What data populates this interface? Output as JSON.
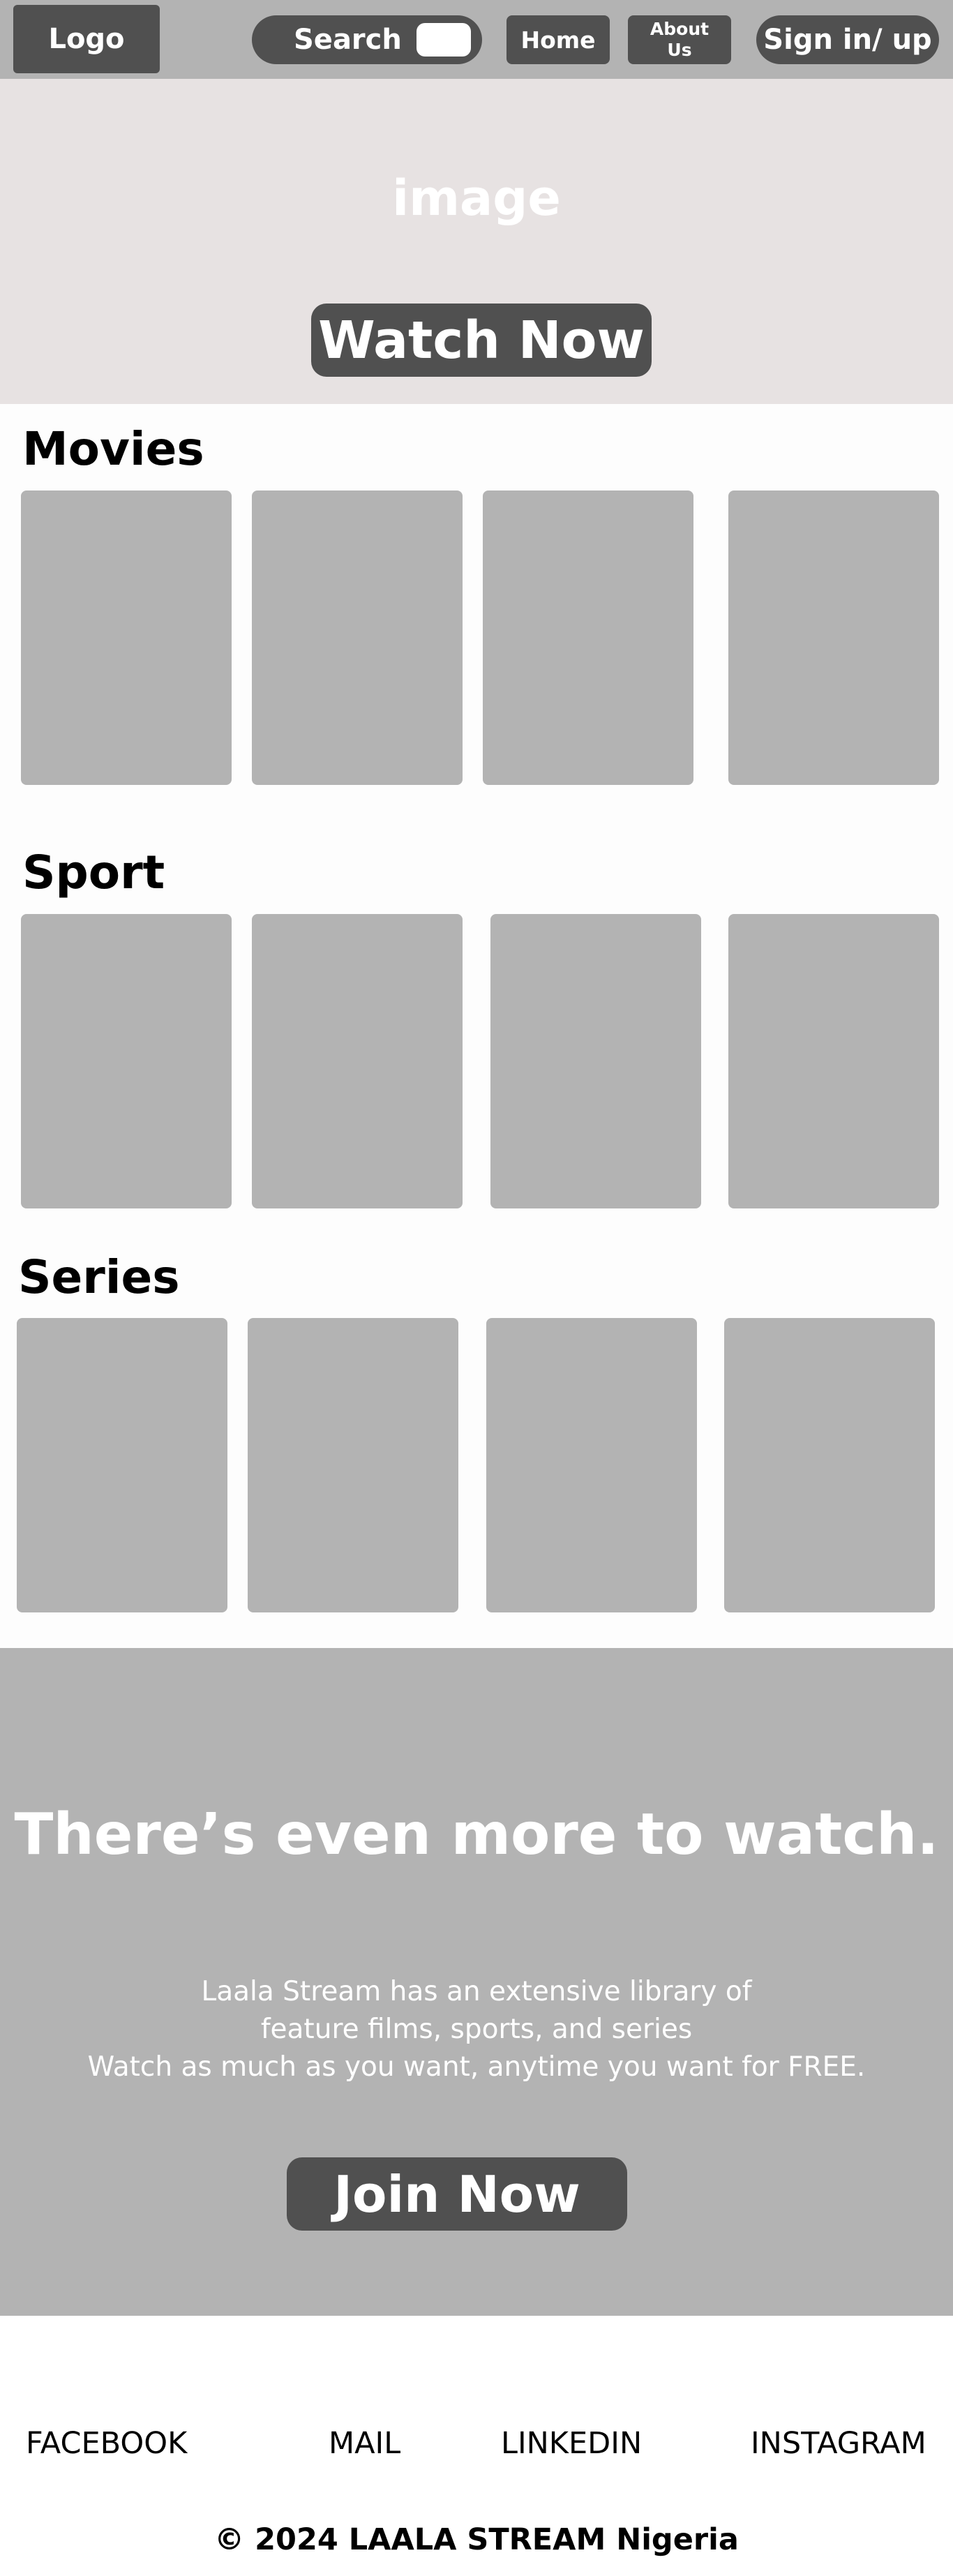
{
  "nav": {
    "logo": "Logo",
    "search_label": "Search",
    "home": "Home",
    "about_line1": "About",
    "about_line2": "Us",
    "signin": "Sign in/ up"
  },
  "hero": {
    "image_label": "image",
    "cta": "Watch Now"
  },
  "sections": {
    "movies": "Movies",
    "sport": "Sport",
    "series": "Series"
  },
  "promo": {
    "heading": "There’s even more to watch.",
    "line1": "Laala Stream has an extensive library of",
    "line2": "feature films, sports, and series",
    "line3": "Watch as much as you want, anytime you want for FREE.",
    "cta": "Join Now"
  },
  "footer": {
    "facebook": "FACEBOOK",
    "mail": "MAIL",
    "linkedin": "LINKEDIN",
    "instagram": "INSTAGRAM",
    "copyright": "© 2024 LAALA STREAM Nigeria"
  },
  "colors": {
    "nav_bg": "#b3b3b3",
    "button_bg": "#505050",
    "hero_bg": "#e7e2e2",
    "card_bg": "#b3b3b3"
  }
}
